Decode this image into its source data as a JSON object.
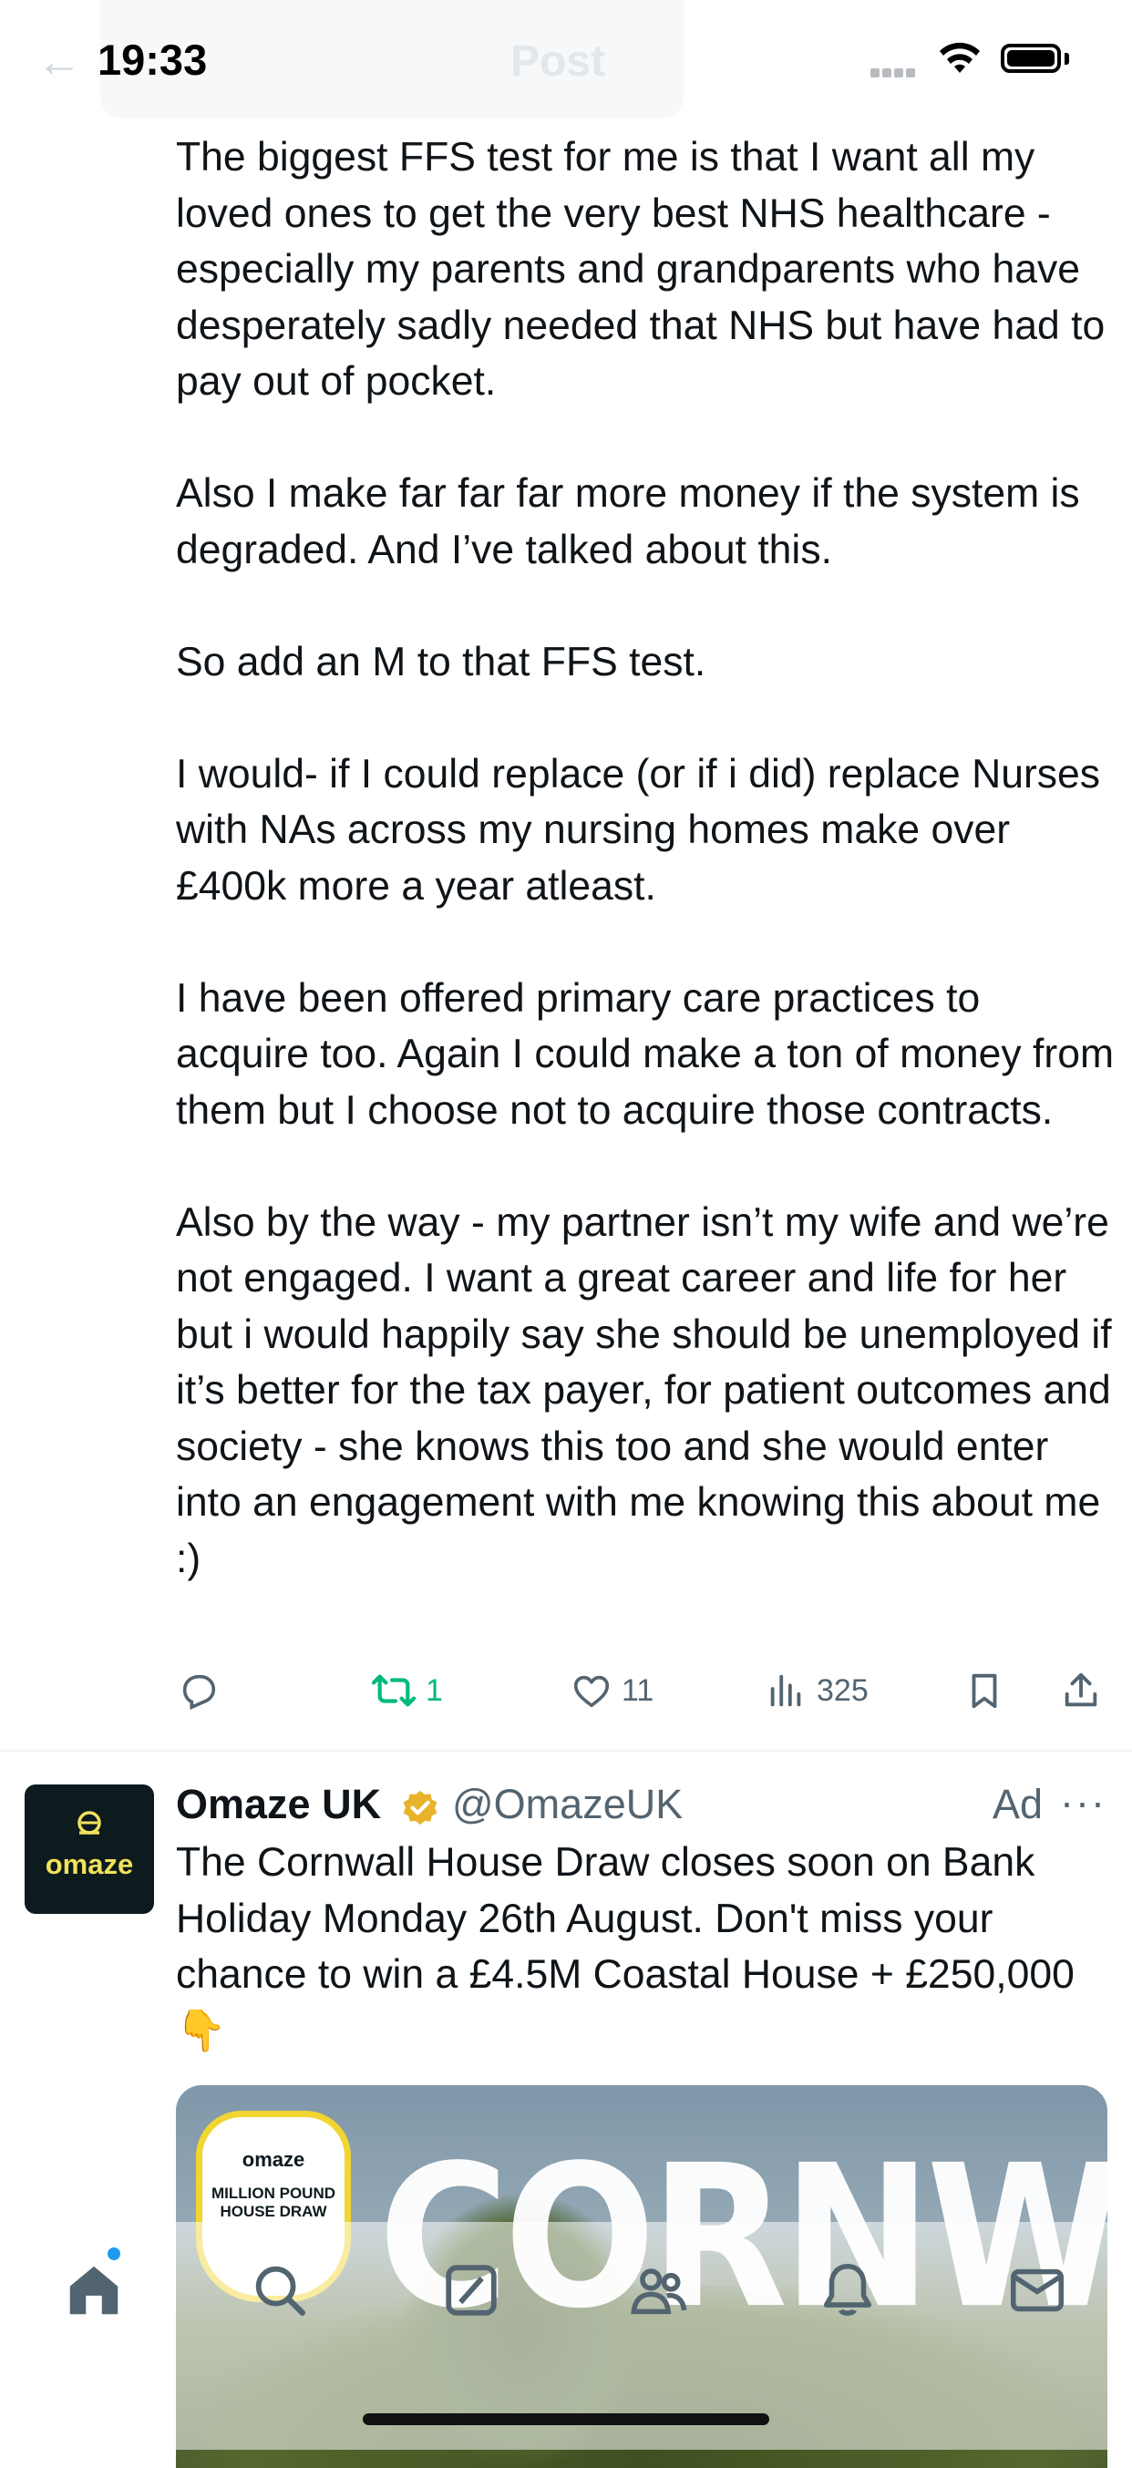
{
  "status_bar": {
    "time": "19:33"
  },
  "header": {
    "title": "Post",
    "back_icon": "arrow-left-icon"
  },
  "tweet": {
    "paragraphs": [
      "The biggest FFS test for me is that I want all my loved ones to get the very best NHS healthcare - especially my parents and grandparents who have desperately sadly needed that NHS but have had to pay out of pocket.",
      "Also I make far far far more money if the system is degraded. And I’ve talked about this.",
      "So add an M to that FFS test.",
      "I would- if I could replace (or if i did) replace Nurses with NAs across my nursing homes make over £400k more a year atleast.",
      "I have been offered primary care practices to acquire too. Again I could make a ton of money from them but I choose not to acquire those contracts.",
      "Also by the way - my partner isn’t my wife and we’re not engaged. I want a great career and life for her but i would happily say she should be unemployed if it’s better for the tax payer, for patient outcomes and society - she knows this too and she would enter into an engagement with me knowing this about me :)"
    ],
    "actions": {
      "reply_count": "",
      "retweet_count": "1",
      "like_count": "11",
      "views_count": "325"
    }
  },
  "ad": {
    "name": "Omaze UK",
    "handle": "@OmazeUK",
    "label": "Ad",
    "more": "···",
    "avatar_text": "omaze",
    "text": "The Cornwall House Draw closes soon on Bank Holiday Monday 26th August. Don't miss your chance to win a £4.5M Coastal House + £250,000 👇",
    "image": {
      "headline": "CORNWALL",
      "badge_brand": "omaze",
      "badge_line1": "MILLION POUND",
      "badge_line2": "HOUSE DRAW"
    }
  },
  "tabbar": {
    "items": [
      "home-icon",
      "search-icon",
      "grok-icon",
      "communities-icon",
      "notifications-icon",
      "messages-icon"
    ]
  },
  "colors": {
    "text": "#0f1419",
    "muted": "#536471",
    "retweet": "#00ba7c",
    "accent": "#1d9bf0",
    "verified": "#e8b32a"
  }
}
